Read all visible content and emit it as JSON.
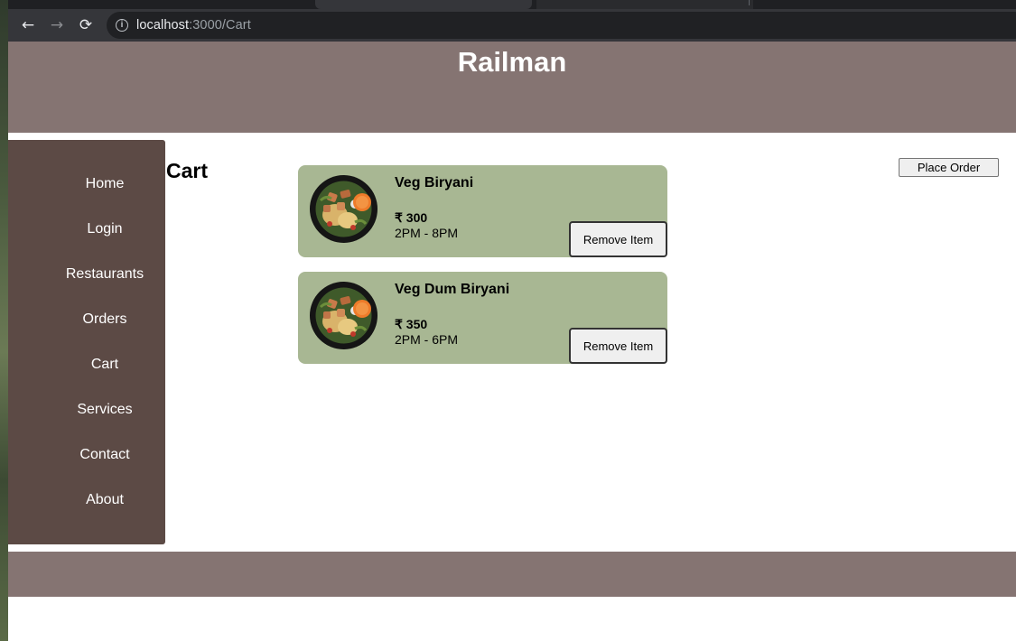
{
  "browser": {
    "url_host": "localhost",
    "url_path": ":3000/Cart",
    "back_icon": "←",
    "forward_icon": "→",
    "reload_icon": "⟳",
    "info_icon": "i"
  },
  "header": {
    "title": "Railman"
  },
  "sidebar": {
    "items": [
      {
        "label": "Home"
      },
      {
        "label": "Login"
      },
      {
        "label": "Restaurants"
      },
      {
        "label": "Orders"
      },
      {
        "label": "Cart"
      },
      {
        "label": "Services"
      },
      {
        "label": "Contact"
      },
      {
        "label": "About"
      }
    ]
  },
  "main": {
    "title": "Cart",
    "place_order_label": "Place Order",
    "items": [
      {
        "name": "Veg Biryani",
        "price": "₹ 300",
        "time": "2PM - 8PM",
        "remove_label": "Remove Item"
      },
      {
        "name": "Veg Dum Biryani",
        "price": "₹ 350",
        "time": "2PM - 6PM",
        "remove_label": "Remove Item"
      }
    ]
  },
  "colors": {
    "header_bg": "#857472",
    "sidebar_bg": "#5c4a45",
    "card_bg": "#a8b793"
  }
}
